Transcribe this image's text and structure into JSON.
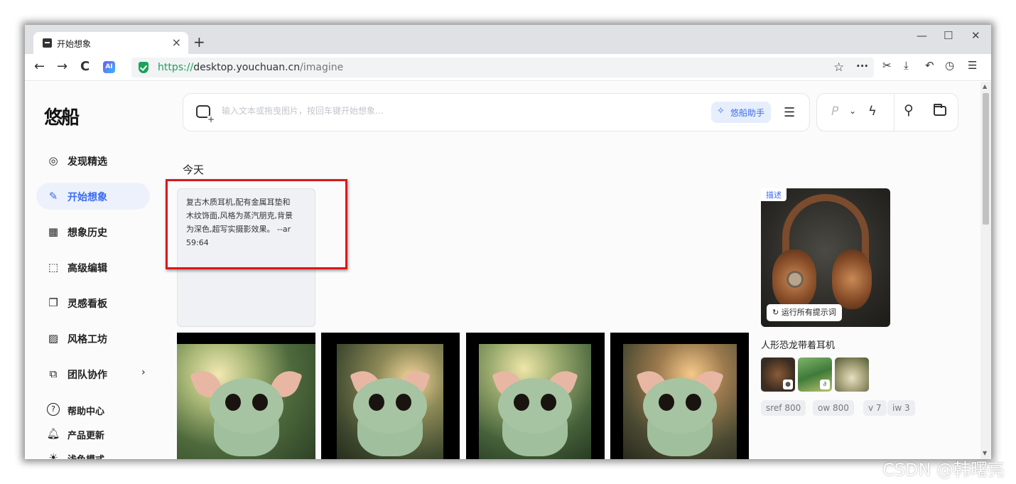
{
  "browser": {
    "tab_title": "开始想象",
    "tab_close": "×",
    "new_tab": "+",
    "url_scheme": "https://",
    "url_host": "desktop.youchuan.cn",
    "url_path": "/imagine",
    "ai_badge": "AI",
    "window_controls": {
      "minimize": "—",
      "maximize": "☐",
      "close": "✕"
    },
    "nav": {
      "back": "←",
      "forward": "→",
      "reload": "C"
    }
  },
  "app": {
    "logo": "悠船",
    "sidebar": {
      "items": [
        {
          "label": "发现精选",
          "icon": "compass-icon",
          "glyph": "◎"
        },
        {
          "label": "开始想象",
          "icon": "brush-icon",
          "glyph": "✎",
          "active": true
        },
        {
          "label": "想象历史",
          "icon": "grid-icon",
          "glyph": "▦"
        },
        {
          "label": "高级编辑",
          "icon": "edit-frame-icon",
          "glyph": "⬚"
        },
        {
          "label": "灵感看板",
          "icon": "copy-icon",
          "glyph": "❐"
        },
        {
          "label": "风格工坊",
          "icon": "pattern-icon",
          "glyph": "▨"
        },
        {
          "label": "团队协作",
          "icon": "team-icon",
          "glyph": "⧉",
          "chevron": "›"
        }
      ],
      "footer": [
        {
          "label": "帮助中心",
          "icon": "help-icon",
          "glyph": "?"
        },
        {
          "label": "产品更新",
          "icon": "bell-icon",
          "glyph": "♫"
        },
        {
          "label": "浅色模式",
          "icon": "sun-icon",
          "glyph": "☀"
        }
      ]
    },
    "prompt": {
      "placeholder": "输入文本或拖曳图片，按回车键开始想象...",
      "assistant_label": "悠船助手"
    },
    "right_tools": {
      "p_badge": "P",
      "chevron": "⌄"
    },
    "section_title": "今天",
    "prompt_card_text": "复古木质耳机,配有金属耳垫和木纹饰面,风格为蒸汽朋克,背景为深色,超写实摄影效果。 --ar 59:64",
    "reference": {
      "tag": "描述",
      "rerun_label": "运行所有提示词",
      "title": "人形恐龙带着耳机",
      "chips": [
        "sref 800",
        "ow 800",
        "v 7",
        "iw 3"
      ]
    }
  },
  "watermark": "CSDN @韩曙亮"
}
